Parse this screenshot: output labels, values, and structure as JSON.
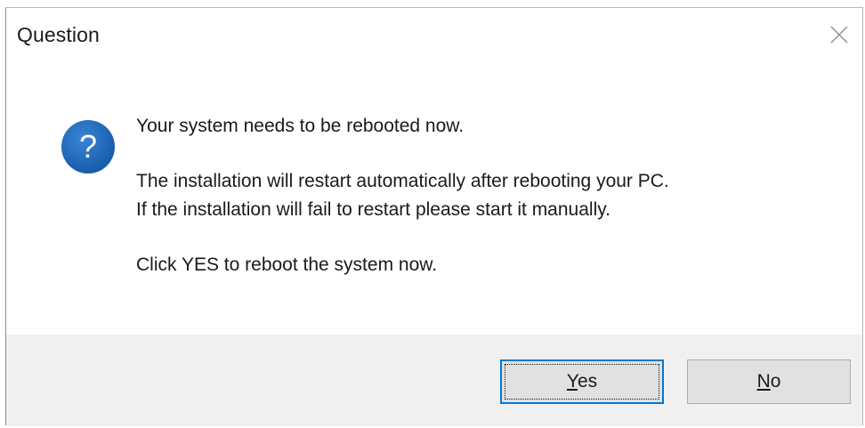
{
  "window": {
    "title": "Question"
  },
  "icon": {
    "name": "question-icon",
    "glyph": "?",
    "color": "#1e66b5"
  },
  "message": {
    "line1": "Your system needs to be rebooted now.",
    "line2": "The installation will restart automatically after rebooting your PC.",
    "line3": "If the installation will fail to restart please start it manually.",
    "line4": "Click YES to reboot the system now."
  },
  "buttons": {
    "yes": {
      "mnemonic": "Y",
      "rest": "es"
    },
    "no": {
      "mnemonic": "N",
      "rest": "o"
    }
  },
  "colors": {
    "accent": "#0078d7",
    "footer_bg": "#f0f0f0",
    "button_bg": "#e1e1e1"
  }
}
